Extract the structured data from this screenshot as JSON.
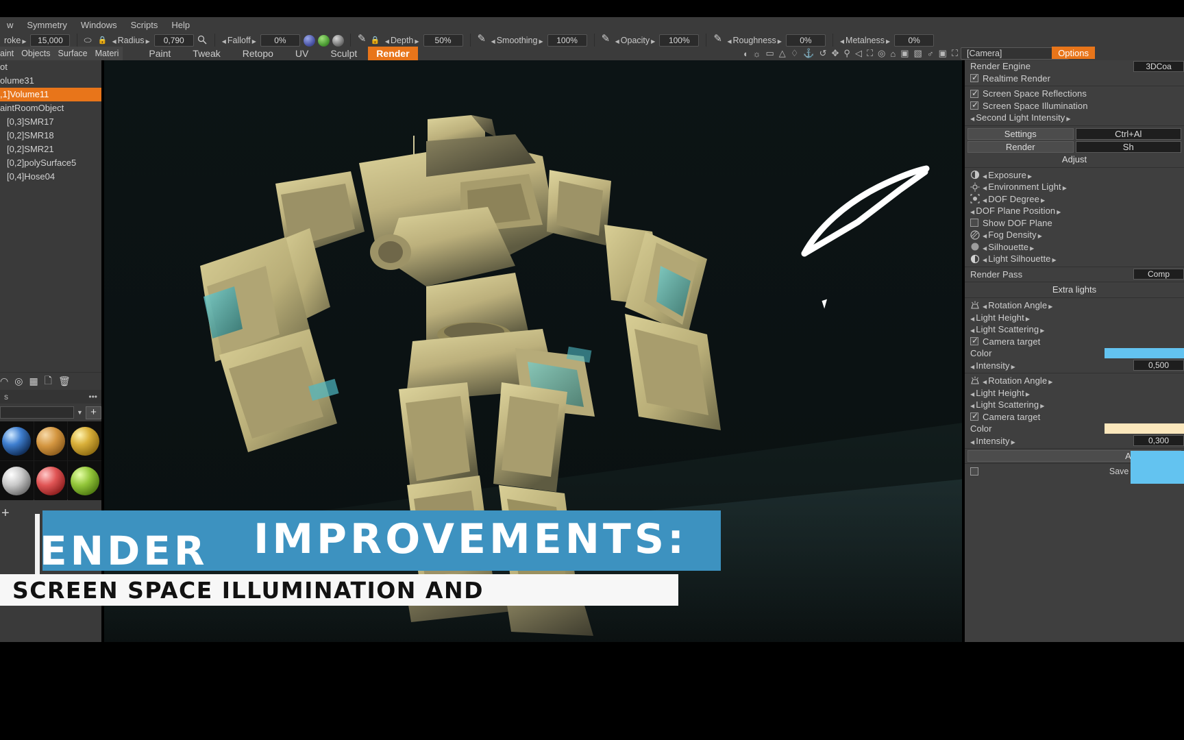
{
  "menubar": {
    "items": [
      "w",
      "Symmetry",
      "Windows",
      "Scripts",
      "Help"
    ]
  },
  "toolbar": {
    "stroke_label": "roke",
    "stroke_value": "15,000",
    "radius_label": "Radius",
    "radius_value": "0,790",
    "falloff_label": "Falloff",
    "falloff_value": "0%",
    "depth_label": "Depth",
    "depth_value": "50%",
    "smoothing_label": "Smoothing",
    "smoothing_value": "100%",
    "opacity_label": "Opacity",
    "opacity_value": "100%",
    "roughness_label": "Roughness",
    "roughness_value": "0%",
    "metalness_label": "Metalness",
    "metalness_value": "0%"
  },
  "roombar": {
    "left_caps": [
      "aint",
      "Objects",
      "Surface",
      "Materi"
    ],
    "tabs": [
      {
        "label": "Paint",
        "active": false
      },
      {
        "label": "Tweak",
        "active": false
      },
      {
        "label": "Retopo",
        "active": false
      },
      {
        "label": "UV",
        "active": false
      },
      {
        "label": "Sculpt",
        "active": false
      },
      {
        "label": "Render",
        "active": true
      }
    ],
    "camera_selector": "[Camera]",
    "options_tab": "Options"
  },
  "left_panel": {
    "objects": [
      {
        "label": "ot",
        "selected": false,
        "indent": false
      },
      {
        "label": "olume31",
        "selected": false,
        "indent": false
      },
      {
        "label": ",1]Volume11",
        "selected": true,
        "indent": false
      },
      {
        "label": "aintRoomObject",
        "selected": false,
        "indent": false
      },
      {
        "label": "[0,3]SMR17",
        "selected": false,
        "indent": true
      },
      {
        "label": "[0,2]SMR18",
        "selected": false,
        "indent": true
      },
      {
        "label": "[0,2]SMR21",
        "selected": false,
        "indent": true
      },
      {
        "label": "[0,2]polySurface5",
        "selected": false,
        "indent": true
      },
      {
        "label": "[0,4]Hose04",
        "selected": false,
        "indent": true
      }
    ],
    "tool_icons": [
      "split-icon",
      "pivot-icon",
      "grid-icon",
      "clear-file-icon",
      "trash-icon"
    ],
    "materials_header": "s",
    "materials_more": "•••",
    "search_placeholder": "",
    "search_value": "",
    "add_button": "+",
    "material_swatches": [
      "blue-material",
      "orange-material",
      "gold-material",
      "white-material",
      "red-material",
      "green-material"
    ],
    "add_layer": "+"
  },
  "right_panel": {
    "render_engine_label": "Render Engine",
    "render_engine_value": "3DCoa",
    "realtime_render_label": "Realtime Render",
    "realtime_render_checked": true,
    "ssr_label": "Screen Space Reflections",
    "ssr_checked": true,
    "ssi_label": "Screen Space Illumination",
    "ssi_checked": true,
    "second_light_intensity_label": "Second Light Intensity",
    "settings_button": "Settings",
    "settings_shortcut": "Ctrl+Al",
    "render_button": "Render",
    "render_shortcut": "Sh",
    "adjust_label": "Adjust",
    "exposure_label": "Exposure",
    "environment_light_label": "Environment  Light",
    "dof_degree_label": "DOF  Degree",
    "dof_plane_position_label": "DOF  Plane  Position",
    "show_dof_plane_label": "Show  DOF  Plane",
    "show_dof_plane_checked": false,
    "fog_density_label": "Fog  Density",
    "silhouette_label": "Silhouette",
    "light_silhouette_label": "Light  Silhouette",
    "render_pass_label": "Render Pass",
    "render_pass_value": "Comp",
    "extra_lights_label": "Extra  lights",
    "lights": [
      {
        "rotation_angle_label": "Rotation  Angle",
        "light_height_label": "Light  Height",
        "light_scattering_label": "Light  Scattering",
        "camera_target_label": "Camera  target",
        "camera_target_checked": true,
        "color_label": "Color",
        "color_value": "#63c3f0",
        "intensity_label": "Intensity",
        "intensity_value": "0,500"
      },
      {
        "rotation_angle_label": "Rotation  Angle",
        "light_height_label": "Light  Height",
        "light_scattering_label": "Light  Scattering",
        "camera_target_label": "Camera  target",
        "camera_target_checked": true,
        "color_label": "Color",
        "color_value": "#fbe7bc",
        "intensity_label": "Intensity",
        "intensity_value": "0,300"
      }
    ],
    "add_light_button": "Add  Light",
    "save_settings_label": "Save  Settings",
    "save_settings_checked": false
  },
  "overlay": {
    "slide_in_word": "ENDER",
    "title": "IMPROVEMENTS:",
    "subtitle": "SCREEN SPACE ILLUMINATION AND",
    "accent_color": "#3d92c0",
    "subtitle_bg": "#f7f7f7"
  }
}
